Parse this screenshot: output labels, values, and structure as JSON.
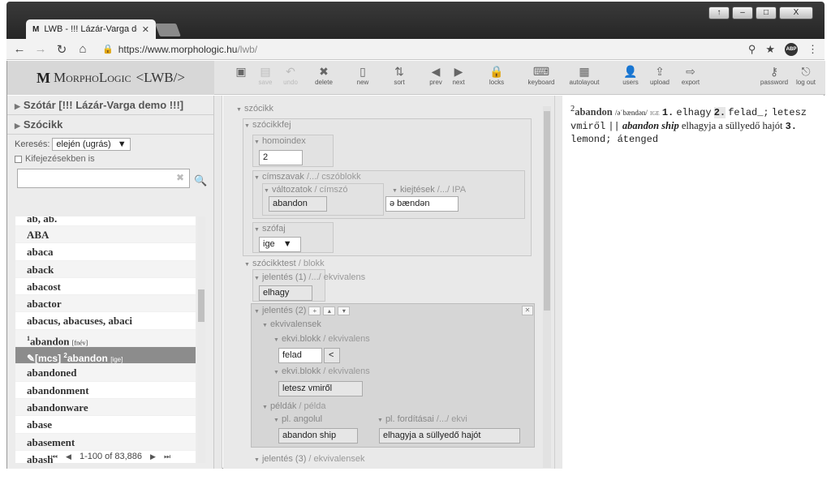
{
  "browser": {
    "tab_title": "LWB - !!! Lázár-Varga de",
    "tab_logo": "M",
    "url_host": "https://www.morphologic.hu",
    "url_path": "/lwb/",
    "window_controls": [
      "↑",
      "–",
      "□",
      "X"
    ],
    "abp_label": "ABP"
  },
  "app": {
    "logo_mark": "M",
    "logo_text": "MorphoLogic",
    "logo_suffix": "<LWB/>",
    "toolbar": [
      {
        "label": "",
        "icon": "▣",
        "enabled": true
      },
      {
        "label": "save",
        "icon": "▤",
        "enabled": false
      },
      {
        "label": "undo",
        "icon": "↶",
        "enabled": false
      },
      {
        "label": "delete",
        "icon": "✖",
        "enabled": true
      },
      {
        "label": "new",
        "icon": "▯",
        "enabled": true
      },
      {
        "label": "sort",
        "icon": "⇅",
        "enabled": true
      },
      {
        "label": "prev",
        "icon": "◀",
        "enabled": true
      },
      {
        "label": "next",
        "icon": "▶",
        "enabled": true
      },
      {
        "label": "locks",
        "icon": "🔒",
        "enabled": true
      },
      {
        "label": "keyboard",
        "icon": "⌨",
        "enabled": true
      },
      {
        "label": "autolayout",
        "icon": "▦",
        "enabled": true
      },
      {
        "label": "users",
        "icon": "👤",
        "enabled": true
      },
      {
        "label": "upload",
        "icon": "⇪",
        "enabled": true
      },
      {
        "label": "export",
        "icon": "⇨",
        "enabled": true
      },
      {
        "label": "password",
        "icon": "⚷",
        "enabled": true
      },
      {
        "label": "log out",
        "icon": "⎋",
        "enabled": true
      }
    ]
  },
  "left": {
    "section1": "Szótár [!!! Lázár-Varga demo !!!]",
    "section2": "Szócikk",
    "search_label": "Keresés:",
    "search_mode": "elején (ugrás)",
    "checkbox_label": "Kifejezésekben is",
    "search_value": "",
    "entries": [
      {
        "text": "ab, ab."
      },
      {
        "text": "ABA"
      },
      {
        "text": "abaca"
      },
      {
        "text": "aback"
      },
      {
        "text": "abacost"
      },
      {
        "text": "abactor"
      },
      {
        "text": "abacus, abacuses, abaci"
      },
      {
        "sup": "1",
        "text": "abandon",
        "tag": "[fnév]"
      },
      {
        "prefix": "✎[mcs] ",
        "sup": "2",
        "text": "abandon",
        "tag": "[ige]",
        "selected": true
      },
      {
        "text": "abandoned"
      },
      {
        "text": "abandonment"
      },
      {
        "text": "abandonware"
      },
      {
        "text": "abase"
      },
      {
        "text": "abasement"
      },
      {
        "text": "abash"
      }
    ],
    "pager": "1-100 of 83,886"
  },
  "editor": {
    "szocikk": "szócikk",
    "szocikkfej": "szócikkfej",
    "homoindex": "homoindex",
    "homoindex_value": "2",
    "cimszavak": "címszavak",
    "cimszavak_sub": "/.../ cszóblokk",
    "valtozatok": "változatok",
    "valtozatok_sub": "/ címszó",
    "cimszo_value": "abandon",
    "kiejtesek": "kiejtések",
    "kiejtesek_sub": "/.../ IPA",
    "ipa_value": "ə bændən",
    "szofaj": "szófaj",
    "szofaj_value": "ige",
    "szocikktest": "szócikktest",
    "szocikktest_sub": "/ blokk",
    "jelentes1": "jelentés (1)",
    "jelentes1_sub": "/.../ ekvivalens",
    "jelentes1_value": "elhagy",
    "jelentes2": "jelentés (2)",
    "ekvivalensek": "ekvivalensek",
    "ekviblokk": "ekvi.blokk",
    "ekviblokk_sub": "/ ekvivalens",
    "ekvi1_value": "felad",
    "ekvi1_btn": "<",
    "ekvi2_value": "letesz vmiről",
    "peldak": "példák",
    "peldak_sub": "/ példa",
    "pl_angolul": "pl. angolul",
    "pl_angolul_value": "abandon ship",
    "pl_forditasai": "pl. fordításai",
    "pl_forditasai_sub": "/.../ ekvi",
    "pl_forditasai_value": "elhagyja a süllyedő hajót",
    "jelentes3": "jelentés (3)",
    "jelentes3_sub": "/ ekvivalensek"
  },
  "preview": {
    "sup": "2",
    "headword": "abandon",
    "ipa": "/əˈbændən/",
    "pos": "IGE",
    "n1": "1.",
    "sense1": "elhagy",
    "n2": "2.",
    "sense2a": "felad_;",
    "sense2b": "letesz vmiről",
    "sep": "||",
    "example": "abandon ship",
    "example_tr": "elhagyja a süllyedő hajót",
    "n3": "3.",
    "sense3": "lemond; átenged"
  }
}
